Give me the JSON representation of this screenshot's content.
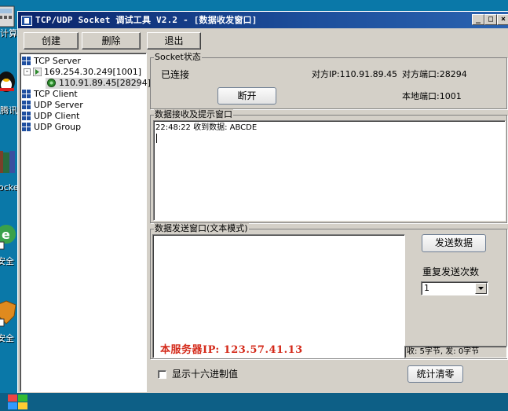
{
  "desktop": {
    "icons": [
      {
        "label": "计算",
        "color": "#3d6fb6"
      },
      {
        "label": "腾讯",
        "color": "#222222"
      },
      {
        "label": "ocket",
        "color": "#7b3f2a"
      },
      {
        "label": "安全",
        "color": "#3aa14a"
      },
      {
        "label": "安全",
        "color": "#e08a1e"
      }
    ]
  },
  "window": {
    "title": "TCP/UDP Socket 调试工具 V2.2 - [数据收发窗口]",
    "controls": {
      "minimize": "_",
      "maximize": "□",
      "close": "×"
    }
  },
  "toolbar": {
    "create_label": "创建",
    "delete_label": "删除",
    "exit_label": "退出"
  },
  "tree": {
    "tcp_server": "TCP Server",
    "server_node": "169.254.30.249[1001]",
    "client_node": "110.91.89.45[28294]",
    "tcp_client": "TCP Client",
    "udp_server": "UDP Server",
    "udp_client": "UDP Client",
    "udp_group": "UDP Group"
  },
  "socket_status": {
    "group_title": "Socket状态",
    "status": "已连接",
    "peer_ip": "对方IP:110.91.89.45",
    "peer_port": "对方端口:28294",
    "local_port": "本地端口:1001",
    "disconnect_label": "断开"
  },
  "receive": {
    "group_title": "数据接收及提示窗口",
    "log_line": "22:48:22 收到数据: ABCDE"
  },
  "send": {
    "group_title": "数据发送窗口(文本模式)",
    "send_label": "发送数据",
    "repeat_label": "重复发送次数",
    "repeat_value": "1",
    "server_ip_note": "本服务器IP: 123.57.41.13",
    "counter": "收: 5字节, 发: 0字节",
    "hex_label": "显示十六进制值",
    "clear_label": "统计清零"
  }
}
